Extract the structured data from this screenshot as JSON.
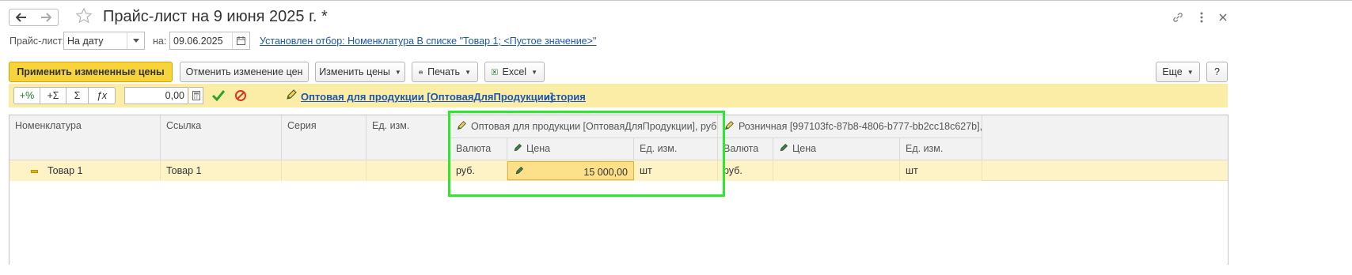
{
  "window": {
    "title": "Прайс-лист на 9 июня 2025 г. *",
    "back_icon": "arrow-left",
    "forward_icon": "arrow-right",
    "favorite_icon": "star",
    "link_icon": "link",
    "menu_icon": "more-vertical",
    "close_icon": "close"
  },
  "filter": {
    "price_list_label": "Прайс-лист:",
    "price_list_value": "На дату",
    "date_label": "на:",
    "date_value": "09.06.2025",
    "selection_link": "Установлен отбор: Номенклатура В списке \"Товар 1; <Пустое значение>\""
  },
  "toolbar": {
    "apply_label": "Применить измененные цены",
    "cancel_label": "Отменить изменение цен",
    "change_label": "Изменить цены",
    "print_label": "Печать",
    "excel_label": "Excel",
    "more_label": "Еще",
    "help_label": "?"
  },
  "panel": {
    "btn_percent": "+%",
    "btn_sum_plus": "+Σ",
    "btn_sum": "Σ",
    "btn_fx": "ƒx",
    "amount_value": "0,00",
    "price_type_link": "Оптовая для продукции [ОптоваяДляПродукции].",
    "history_link": "история"
  },
  "table": {
    "headers": {
      "nomenclature": "Номенклатура",
      "link": "Ссылка",
      "series": "Серия",
      "unit": "Ед. изм.",
      "wholesale_group": "Оптовая для продукции [ОптоваяДляПродукции], руб.",
      "retail_group": "Розничная [997103fc-87b8-4806-b777-bb2cc18c627b],..."
    },
    "subheaders": {
      "w_currency": "Валюта",
      "w_price": "Цена",
      "w_unit": "Ед. изм.",
      "r_currency": "Валюта",
      "r_price": "Цена",
      "r_unit": "Ед. изм."
    },
    "row": {
      "nomenclature": "Товар 1",
      "link": "Товар 1",
      "series": "",
      "unit": "",
      "w_currency": "руб.",
      "w_price": "15 000,00",
      "w_unit": "шт",
      "r_currency": "руб.",
      "r_price": "",
      "r_unit": "шт"
    }
  },
  "colors": {
    "primary_button": "#f7d43c",
    "panel_background": "#fbeda5",
    "row_background": "#fdf3c7",
    "edited_cell": "#fde08a",
    "link": "#1a55b5",
    "highlight_frame": "#2ee830"
  }
}
